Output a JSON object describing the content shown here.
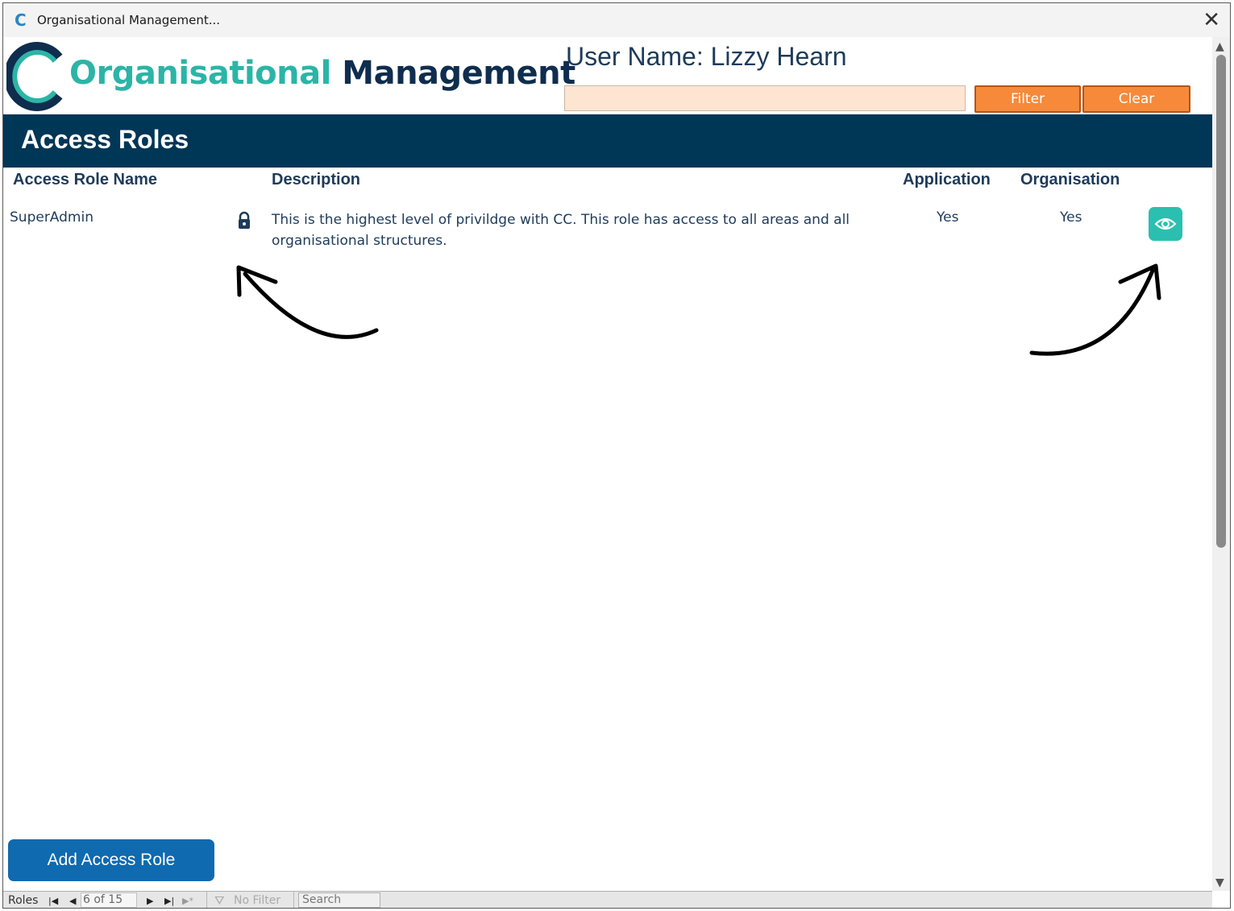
{
  "window": {
    "title": "Organisational Management..."
  },
  "header": {
    "logo_part1": "Organisational",
    "logo_part2": "Management",
    "user_name_label": "User Name: Lizzy Hearn",
    "filter_value": "",
    "filter_button": "Filter",
    "clear_button": "Clear"
  },
  "section": {
    "title": "Access Roles"
  },
  "table": {
    "columns": [
      "Access Role Name",
      "Description",
      "Application",
      "Organisation"
    ],
    "rows": [
      {
        "name": "SuperAdmin",
        "locked": true,
        "description": "This is the highest level of privildge with CC.  This role has access to all areas and all organisational structures.",
        "application": "Yes",
        "organisation": "Yes",
        "action_icon": "eye-icon"
      }
    ]
  },
  "footer": {
    "add_button": "Add Access Role"
  },
  "record_nav": {
    "label": "Roles",
    "current": "6 of 15",
    "filter_status": "No Filter",
    "search_placeholder": "Search"
  },
  "colors": {
    "brand_teal": "#2bb5a6",
    "brand_navy": "#003656",
    "accent_orange": "#f68a3a",
    "button_blue": "#0f6ab0"
  }
}
